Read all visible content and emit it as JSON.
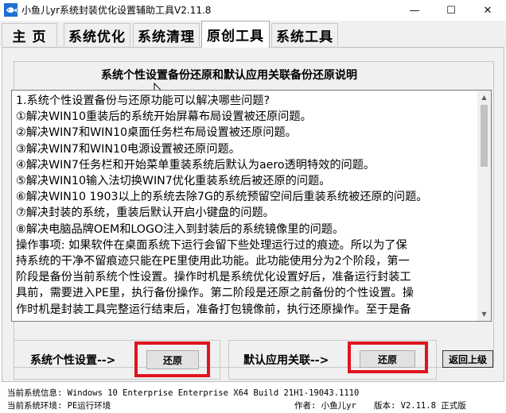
{
  "window": {
    "title": "小鱼儿yr系统封装优化设置辅助工具V2.11.8",
    "minimize_glyph": "—",
    "maximize_glyph": "☐",
    "close_glyph": "✕"
  },
  "tabs": [
    {
      "label": "主 页",
      "active": false
    },
    {
      "label": "系统优化",
      "active": false
    },
    {
      "label": "系统清理",
      "active": false
    },
    {
      "label": "原创工具",
      "active": true
    },
    {
      "label": "系统工具",
      "active": false
    }
  ],
  "panel": {
    "heading": "系统个性设置备份还原和默认应用关联备份还原说明",
    "description": "1.系统个性设置备份与还原功能可以解决哪些问题?\n①解决WIN10重装后的系统开始屏幕布局设置被还原问题。\n②解决WIN7和WIN10桌面任务栏布局设置被还原问题。\n③解决WIN7和WIN10电源设置被还原问题。\n④解决WIN7任务栏和开始菜单重装系统后默认为aero透明特效的问题。\n⑤解决WIN10输入法切换WIN7优化重装系统后被还原的问题。\n⑥解决WIN10 1903以上的系统去除7G的系统预留空间后重装系统被还原的问题。\n⑦解决封装的系统，重装后默认开启小键盘的问题。\n⑧解决电脑品牌OEM和LOGO注入到封装后的系统镜像里的问题。\n操作事项: 如果软件在桌面系统下运行会留下些处理运行过的痕迹。所以为了保\n持系统的干净不留痕迹只能在PE里使用此功能。此功能使用分为2个阶段，第一\n阶段是备份当前系统个性设置。操作时机是系统优化设置好后，准备运行封装工\n具前，需要进入PE里，执行备份操作。第二阶段是还原之前备份的个性设置。操\n作时机是封装工具完整运行结束后，准备打包镜像前，执行还原操作。至于是备"
  },
  "personal_settings": {
    "label": "系统个性设置-->",
    "button": "还原"
  },
  "default_apps": {
    "label": "默认应用关联-->",
    "button": "还原"
  },
  "back_button": "返回上级",
  "status_bar": {
    "system_info": "当前系统信息: Windows 10 Enterprise Enterprise X64 Build 21H1-19043.1110",
    "system_env": "当前系统环境: PE运行环境",
    "author": "作者: 小鱼儿yr",
    "version": "版本: V2.11.8 正式版"
  },
  "colors": {
    "highlight_frame": "#e0141e",
    "panel_bg": "#f0f0f0",
    "button_bg": "#e1e1e1"
  }
}
